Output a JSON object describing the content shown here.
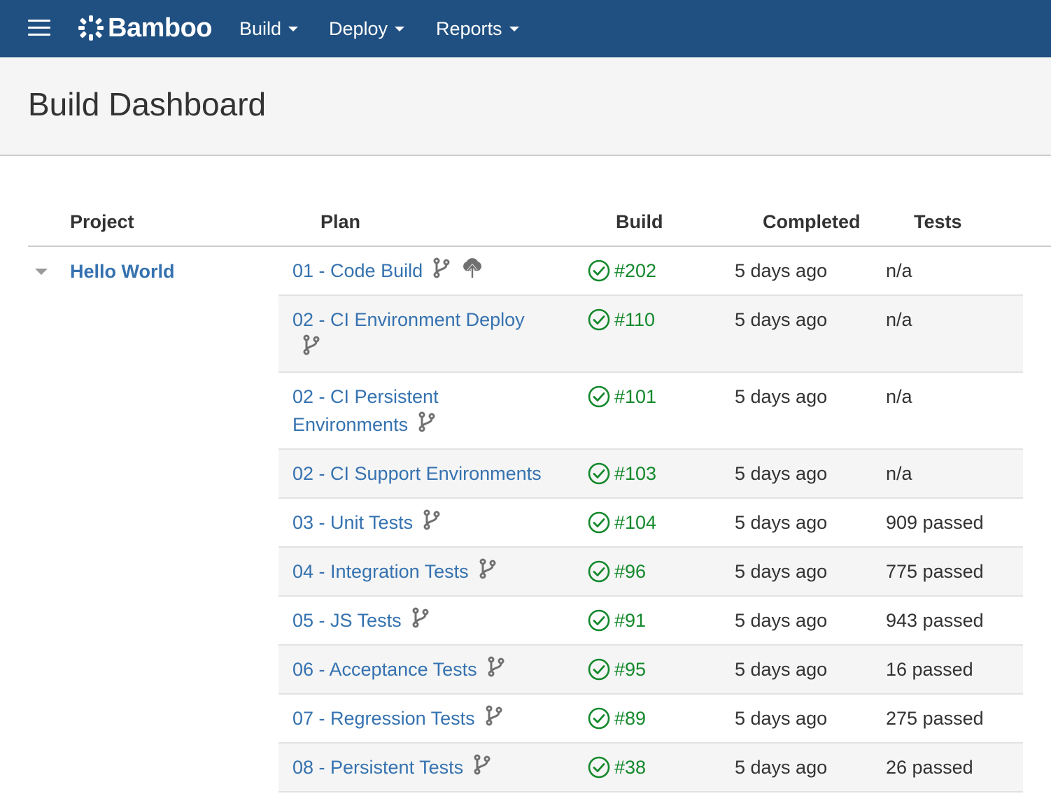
{
  "app": {
    "name": "Bamboo"
  },
  "nav": [
    {
      "label": "Build"
    },
    {
      "label": "Deploy"
    },
    {
      "label": "Reports"
    }
  ],
  "page": {
    "title": "Build Dashboard"
  },
  "table": {
    "headers": {
      "project": "Project",
      "plan": "Plan",
      "build": "Build",
      "completed": "Completed",
      "tests": "Tests"
    },
    "project": {
      "name": "Hello World"
    },
    "rows": [
      {
        "plan": "01 - Code Build",
        "build": "#202",
        "completed": "5 days ago",
        "tests": "n/a",
        "icons": [
          "branch-icon",
          "deploy-cloud-icon"
        ]
      },
      {
        "plan": "02 - CI Environment Deploy",
        "build": "#110",
        "completed": "5 days ago",
        "tests": "n/a",
        "icons": [
          "branch-icon"
        ]
      },
      {
        "plan": "02 - CI Persistent Environments",
        "build": "#101",
        "completed": "5 days ago",
        "tests": "n/a",
        "icons": [
          "branch-icon"
        ]
      },
      {
        "plan": "02 - CI Support Environments",
        "build": "#103",
        "completed": "5 days ago",
        "tests": "n/a",
        "icons": []
      },
      {
        "plan": "03 - Unit Tests",
        "build": "#104",
        "completed": "5 days ago",
        "tests": "909 passed",
        "icons": [
          "branch-icon"
        ]
      },
      {
        "plan": "04 - Integration Tests",
        "build": "#96",
        "completed": "5 days ago",
        "tests": "775 passed",
        "icons": [
          "branch-icon"
        ]
      },
      {
        "plan": "05 - JS Tests",
        "build": "#91",
        "completed": "5 days ago",
        "tests": "943 passed",
        "icons": [
          "branch-icon"
        ]
      },
      {
        "plan": "06 - Acceptance Tests",
        "build": "#95",
        "completed": "5 days ago",
        "tests": "16 passed",
        "icons": [
          "branch-icon"
        ]
      },
      {
        "plan": "07 - Regression Tests",
        "build": "#89",
        "completed": "5 days ago",
        "tests": "275 passed",
        "icons": [
          "branch-icon"
        ]
      },
      {
        "plan": "08 - Persistent Tests",
        "build": "#38",
        "completed": "5 days ago",
        "tests": "26 passed",
        "icons": [
          "branch-icon"
        ]
      }
    ]
  },
  "colors": {
    "header_bg": "#205081",
    "link": "#3572b0",
    "success": "#14892c",
    "row_alt": "#f5f5f5"
  }
}
